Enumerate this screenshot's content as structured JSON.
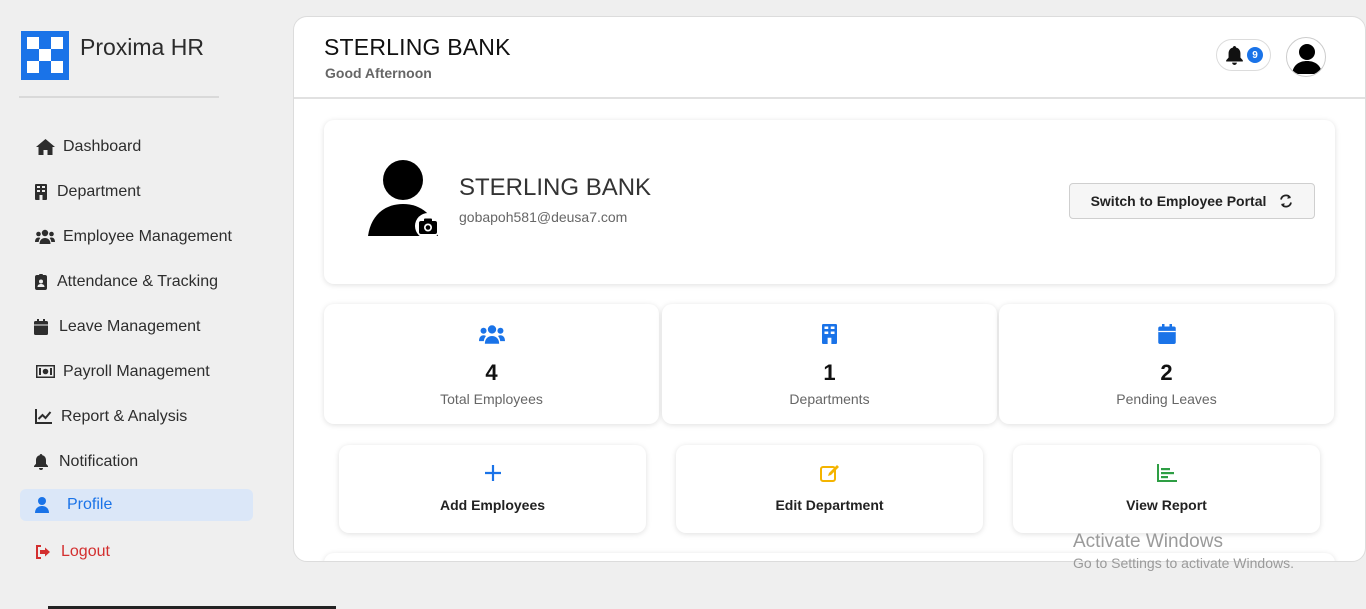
{
  "brand": {
    "name": "Proxima HR"
  },
  "nav": [
    {
      "label": "Dashboard",
      "icon": "home-icon"
    },
    {
      "label": "Department",
      "icon": "building-icon"
    },
    {
      "label": "Employee Management",
      "icon": "users-icon"
    },
    {
      "label": "Attendance & Tracking",
      "icon": "id-badge-icon"
    },
    {
      "label": "Leave Management",
      "icon": "calendar-icon"
    },
    {
      "label": "Payroll Management",
      "icon": "money-bill-icon"
    },
    {
      "label": "Report & Analysis",
      "icon": "chart-line-icon"
    },
    {
      "label": "Notification",
      "icon": "bell-icon"
    },
    {
      "label": "Profile",
      "icon": "user-icon",
      "active": true
    },
    {
      "label": "Logout",
      "icon": "sign-out-icon"
    }
  ],
  "header": {
    "title": "STERLING BANK",
    "greeting": "Good Afternoon",
    "notification_count": "9"
  },
  "profile": {
    "name": "STERLING BANK",
    "email": "gobapoh581@deusa7.com",
    "switch_label": "Switch to Employee Portal"
  },
  "stats": [
    {
      "value": "4",
      "label": "Total Employees",
      "icon": "users-icon"
    },
    {
      "value": "1",
      "label": "Departments",
      "icon": "building-icon"
    },
    {
      "value": "2",
      "label": "Pending Leaves",
      "icon": "calendar-icon"
    }
  ],
  "actions": [
    {
      "label": "Add Employees",
      "icon": "plus-icon"
    },
    {
      "label": "Edit Department",
      "icon": "edit-icon"
    },
    {
      "label": "View Report",
      "icon": "chart-icon"
    }
  ],
  "watermark": {
    "line1": "Activate Windows",
    "line2": "Go to Settings to activate Windows."
  },
  "colors": {
    "accent": "#1a73e8",
    "logout": "#d32f2f",
    "edit": "#f4b400",
    "report": "#2e9e44"
  }
}
